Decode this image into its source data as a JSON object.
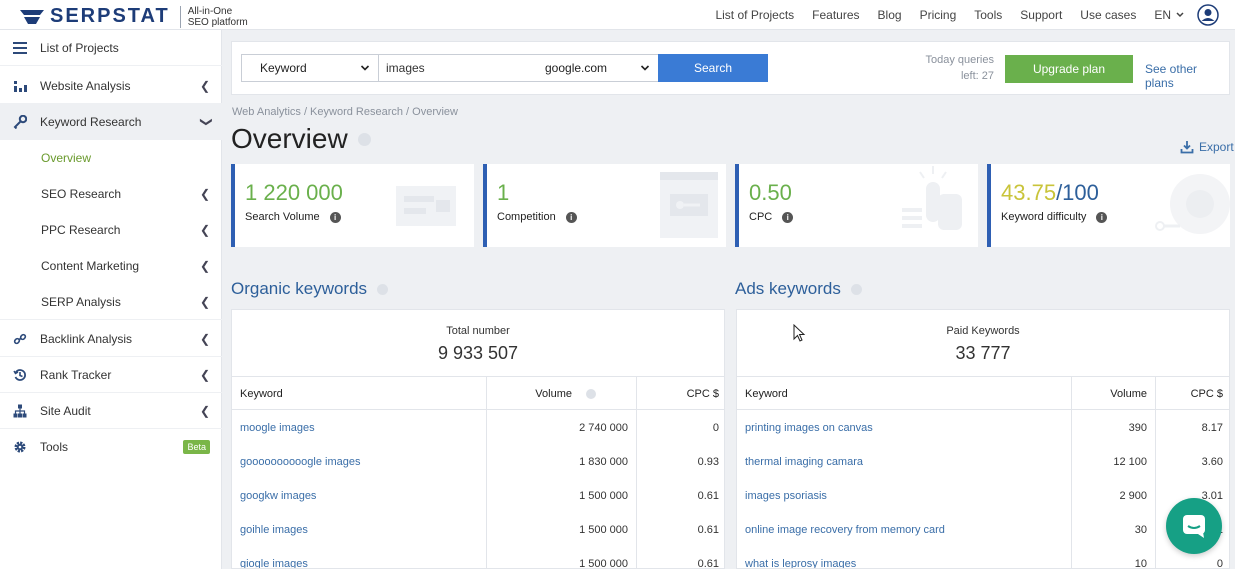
{
  "brand": {
    "name": "SERPSTAT",
    "tagline_1": "All-in-One",
    "tagline_2": "SEO platform"
  },
  "topnav": [
    "List of Projects",
    "Features",
    "Blog",
    "Pricing",
    "Tools",
    "Support",
    "Use cases"
  ],
  "language": "EN",
  "sidebar": {
    "items": [
      {
        "label": "List of Projects",
        "icon": "menu-icon"
      },
      {
        "label": "Website Analysis",
        "icon": "chart-icon"
      },
      {
        "label": "Keyword Research",
        "icon": "key-icon"
      },
      {
        "label": "Overview"
      },
      {
        "label": "SEO Research"
      },
      {
        "label": "PPC Research"
      },
      {
        "label": "Content Marketing"
      },
      {
        "label": "SERP Analysis"
      },
      {
        "label": "Backlink Analysis",
        "icon": "link-icon"
      },
      {
        "label": "Rank Tracker",
        "icon": "history-icon"
      },
      {
        "label": "Site Audit",
        "icon": "sitemap-icon"
      },
      {
        "label": "Tools",
        "icon": "gear-icon"
      }
    ],
    "beta": "Beta"
  },
  "search": {
    "type": "Keyword",
    "query": "images",
    "database": "google.com",
    "button": "Search",
    "queries_1": "Today queries",
    "queries_2": "left: 27",
    "upgrade": "Upgrade plan",
    "other_plans": "See other plans"
  },
  "breadcrumb": "Web Analytics / Keyword Research / Overview",
  "page_title": "Overview",
  "export": "Export",
  "cards": [
    {
      "value": "1 220 000",
      "label": "Search Volume"
    },
    {
      "value": "1",
      "label": "Competition"
    },
    {
      "value": "0.50",
      "label": "CPC"
    },
    {
      "value": "43.75",
      "suffix": "/100",
      "label": "Keyword difficulty"
    }
  ],
  "organic": {
    "title": "Organic keywords",
    "total_label": "Total number",
    "total": "9 933 507",
    "columns": [
      "Keyword",
      "Volume",
      "CPC $"
    ],
    "rows": [
      {
        "keyword": "moogle images",
        "volume": "2 740 000",
        "cpc": "0"
      },
      {
        "keyword": "goooooooooogle images",
        "volume": "1 830 000",
        "cpc": "0.93"
      },
      {
        "keyword": "googkw images",
        "volume": "1 500 000",
        "cpc": "0.61"
      },
      {
        "keyword": "goihle images",
        "volume": "1 500 000",
        "cpc": "0.61"
      },
      {
        "keyword": "giogle images",
        "volume": "1 500 000",
        "cpc": "0.61"
      }
    ]
  },
  "ads": {
    "title": "Ads keywords",
    "total_label": "Paid Keywords",
    "total": "33 777",
    "columns": [
      "Keyword",
      "Volume",
      "CPC $"
    ],
    "rows": [
      {
        "keyword": "printing images on canvas",
        "volume": "390",
        "cpc": "8.17"
      },
      {
        "keyword": "thermal imaging camara",
        "volume": "12 100",
        "cpc": "3.60"
      },
      {
        "keyword": "images psoriasis",
        "volume": "2 900",
        "cpc": "3.01"
      },
      {
        "keyword": "online image recovery from memory card",
        "volume": "30",
        "cpc": "0.61"
      },
      {
        "keyword": "what is leprosy images",
        "volume": "10",
        "cpc": "0"
      }
    ]
  },
  "colors": {
    "brand": "#1d3c78",
    "accent": "#3a7bd5",
    "green": "#6ab04c",
    "link": "#3a6ea8"
  }
}
